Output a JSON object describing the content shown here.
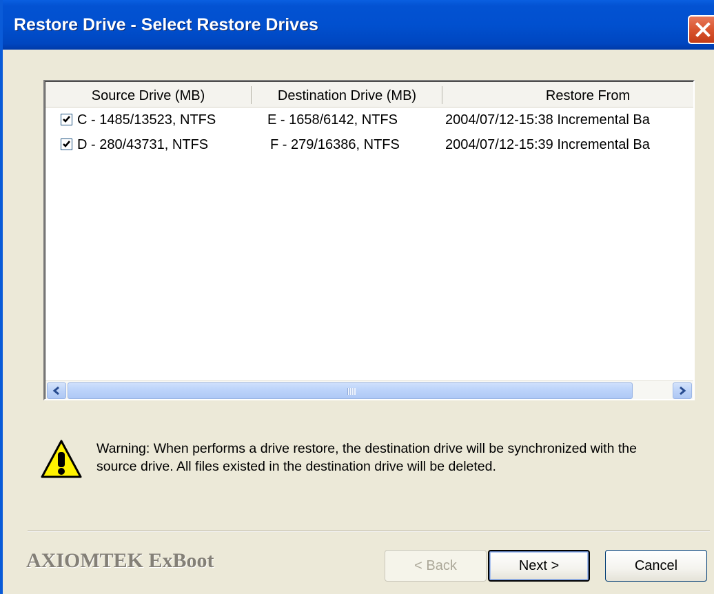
{
  "window": {
    "title": "Restore Drive - Select Restore Drives"
  },
  "listview": {
    "columns": [
      "Source Drive (MB)",
      "Destination Drive (MB)",
      "Restore From"
    ],
    "rows": [
      {
        "checked": true,
        "source": "C - 1485/13523, NTFS",
        "destination": "E - 1658/6142, NTFS",
        "restore_from": "2004/07/12-15:38 Incremental Ba"
      },
      {
        "checked": true,
        "source": "D - 280/43731, NTFS",
        "destination": "F - 279/16386, NTFS",
        "restore_from": "2004/07/12-15:39 Incremental Ba"
      }
    ]
  },
  "warning": {
    "icon": "warning-icon",
    "line1": "Warning: When performs a drive restore, the destination drive will be synchronized with the",
    "line2": "source drive. All files existed in the destination drive will be deleted."
  },
  "footer": {
    "brand": "AXIOMTEK ExBoot",
    "back_label": "< Back",
    "next_label": "Next >",
    "cancel_label": "Cancel"
  },
  "colors": {
    "titlebar": "#0150cf",
    "dialog_bg": "#ece9d8",
    "close_button": "#d9552f"
  }
}
